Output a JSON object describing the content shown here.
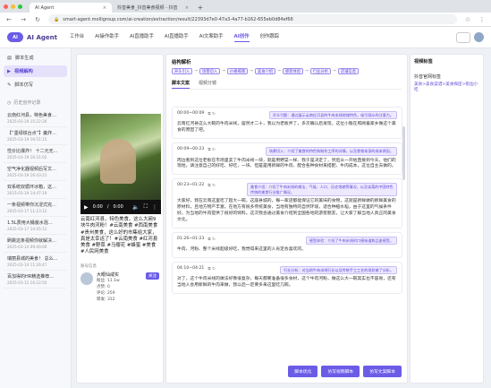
{
  "browser": {
    "tabs": [
      {
        "label": "AI Agent",
        "active": true
      },
      {
        "label": "抖音美食_抖音美食视频 - 抖音",
        "active": false
      }
    ],
    "url": "smart-agent.molligroup.com/ai-creation/extraction/result/22393d7e0-47a3-4a77-b162-655eb0d84ef66"
  },
  "header": {
    "logo_text": "AI Agent",
    "nav": [
      "工作台",
      "AI操作助手",
      "AI直播助手",
      "AI直播助手",
      "AI文案助手",
      "AI创作",
      "创作跟踪"
    ],
    "active_nav": 5
  },
  "sidebar": {
    "items": [
      {
        "label": "脚本生成",
        "icon": "doc-icon",
        "active": false
      },
      {
        "label": "视频解构",
        "icon": "video-icon",
        "active": true
      },
      {
        "label": "脚本仿写",
        "icon": "pen-icon",
        "active": false
      }
    ],
    "history_title": "历史创作记录",
    "history": [
      {
        "title": "云南红河县，特色美食…",
        "time": "2025-03-19 15:22:26"
      },
      {
        "title": "【“墨绿铁台点”】羹炸…",
        "time": "2025-03-19 16:51:15"
      },
      {
        "title": "性价比爆炸！ 十二元无…",
        "time": "2025-03-19 16:31:02"
      },
      {
        "title": "空气净化器视频后写文…",
        "time": "2025-03-19 16:43:21"
      },
      {
        "title": "双系统双循环冰箱，这…",
        "time": "2025-03-19 14:47:19"
      },
      {
        "title": "一条视频带你沉浸式完…",
        "time": "2025-03-17 11:23:12"
      },
      {
        "title": "1.5L费用大桶装水混…",
        "time": "2025-03-17 14:45:12"
      },
      {
        "title": "刷跳这条视频你就解决…",
        "time": "2025-03-14 09:40:00"
      },
      {
        "title": "瑞丽县城的美食！ 总么…",
        "time": "2025-03-14 11:26:47"
      },
      {
        "title": "百加得的HR精选推荐…",
        "time": "2025-03-12 16:22:50"
      }
    ]
  },
  "video_panel": {
    "time_current": "0:00",
    "time_total": "0:00",
    "caption": "云南红河县，特色美食。这么大碗9块牛肉河粉！#云南美食 #西南美食 #贵州美食，这么好的市集给大家，真是太幸运了！#云南美食 #红河县美食 #野菜 #马缨花 #蜂蜜 #美食 #人民网美食",
    "meta_label": "账号信息",
    "author_name": "大眼仙咸实",
    "author_followers": "粉丝: 11.1w",
    "author_likes": "点赞: 0",
    "author_comments": "评论: 259",
    "author_shares": "转发: 312",
    "follow_label": "关注"
  },
  "structure": {
    "title": "结构解析",
    "chips": [
      "开头引入",
      "场景切入",
      "价格揭晓",
      "美食介绍",
      "感受体验",
      "行业分析",
      "店铺信息"
    ],
    "subtabs": [
      "脚本文案",
      "视频分镜"
    ],
    "active_subtab": 0
  },
  "transcript": [
    {
      "time": "00:00~00:09",
      "tag": "开头引题：通过展示云南红河县的牛肉米线地域特色，吸引观众的注意力。",
      "text": "云南红河县这么大碗的牛肉米线，居然才二十，我以为老板弄了，多次确认后发现，这位小贩在照顾着家乡做这个美食的原因了吧。"
    },
    {
      "time": "00:09~00:23",
      "tag": "场景切入：介绍了美食的特色和制作工序的详情，以及食物本身的成本原因。",
      "text": "周边看到这位老板在市场里卖了牛肉米线一块，就是用野菜一样、我于是决定了，然后从一开始直接到今天，他们的现地，请注意自己的好吃、好吃，一块、但是是用新鲜的牛肉、配合各种食材来搭配、牛肉成本，这位自主去做的。"
    },
    {
      "time": "00:23~01:22",
      "tag": "美食介绍：介绍了牛肉米线的做法、气候、人口、历史地貌等情况，以及该菜的中国特色传统的美食行业推广情况。",
      "text": "大家好，我在云南这里吃了超大一碗，这座县城的，每一家店都能保证它的美味的食物，这就是新鲜做的新鲜美食的原材料，且地方物产丰富。在地方有很多传统美食，当地有独特的自然环境，适合种植水稻，由于这里的气候条件好，为当地的牛肉提供了很好的饲料。这次我会通过美食介绍到全国各地的游客朋友，让大家了解当地人真正的美食文化。"
    },
    {
      "time": "01:26~01:23",
      "tag": "感受体验：介绍了牛肉米线的口感味道和品鉴感受。",
      "text": "牛肉、河粉、整个米线超级好吃，我觉得来这里的人肯定会喜欢的。"
    },
    {
      "time": "04:10~04:21",
      "tag": "行业分析：对当地牛肉米线行业以及传统手工工艺的现状做了分析。",
      "text": "对了，这个牛肉米线的做法好像很复杂，每天都要准备很多食材，这个牛肉河粉，做这么大一碗其实也不容易，还有当地人会用新鲜的牛肉来做，我以后一定要多来这里吃几碗。"
    }
  ],
  "bottom_buttons": [
    "脚本优化",
    "仿写视频脚本",
    "仿写文案脚本"
  ],
  "right_panel": {
    "title": "视频标签",
    "sub_title": "抖音官网标签",
    "link": "美食>美食菜谱>美食探店>街边小吃"
  }
}
